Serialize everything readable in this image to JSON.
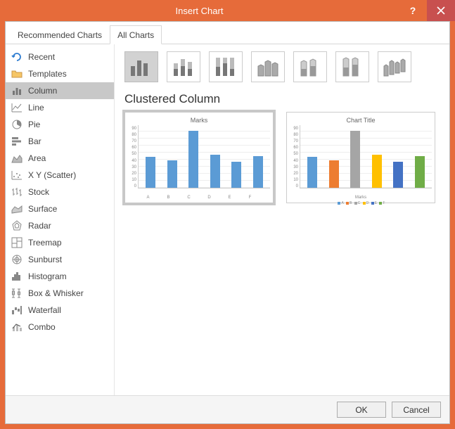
{
  "titlebar": {
    "title": "Insert Chart"
  },
  "tabs": {
    "recommended": "Recommended Charts",
    "all": "All Charts",
    "active": "All Charts"
  },
  "sidebar": [
    {
      "label": "Recent",
      "key": "recent"
    },
    {
      "label": "Templates",
      "key": "templates"
    },
    {
      "label": "Column",
      "key": "column",
      "selected": true
    },
    {
      "label": "Line",
      "key": "line"
    },
    {
      "label": "Pie",
      "key": "pie"
    },
    {
      "label": "Bar",
      "key": "bar"
    },
    {
      "label": "Area",
      "key": "area"
    },
    {
      "label": "X Y (Scatter)",
      "key": "xy"
    },
    {
      "label": "Stock",
      "key": "stock"
    },
    {
      "label": "Surface",
      "key": "surface"
    },
    {
      "label": "Radar",
      "key": "radar"
    },
    {
      "label": "Treemap",
      "key": "treemap"
    },
    {
      "label": "Sunburst",
      "key": "sunburst"
    },
    {
      "label": "Histogram",
      "key": "histogram"
    },
    {
      "label": "Box & Whisker",
      "key": "box"
    },
    {
      "label": "Waterfall",
      "key": "waterfall"
    },
    {
      "label": "Combo",
      "key": "combo"
    }
  ],
  "subtype_title": "Clustered Column",
  "footer": {
    "ok": "OK",
    "cancel": "Cancel"
  },
  "chart_data": [
    {
      "type": "bar",
      "title": "Marks",
      "categories": [
        "A",
        "B",
        "C",
        "D",
        "E",
        "F"
      ],
      "values": [
        45,
        40,
        82,
        48,
        38,
        46
      ],
      "ylim": [
        0,
        90
      ],
      "yticks": [
        0,
        10,
        20,
        30,
        40,
        50,
        60,
        70,
        80,
        90
      ],
      "xlabel": "",
      "ylabel": ""
    },
    {
      "type": "bar",
      "title": "Chart Title",
      "categories": [
        "A",
        "B",
        "C",
        "D",
        "E",
        "F"
      ],
      "series": [
        {
          "name": "Marks",
          "values": [
            45,
            40,
            82,
            48,
            38,
            46
          ]
        }
      ],
      "ylim": [
        0,
        90
      ],
      "yticks": [
        0,
        10,
        20,
        30,
        40,
        50,
        60,
        70,
        80,
        90
      ],
      "xlabel": "Marks",
      "ylabel": "",
      "legend": [
        "A",
        "B",
        "C",
        "D",
        "E",
        "F"
      ],
      "colors": [
        "#5b9bd5",
        "#ed7d31",
        "#a5a5a5",
        "#ffc000",
        "#4472c4",
        "#70ad47"
      ]
    }
  ]
}
